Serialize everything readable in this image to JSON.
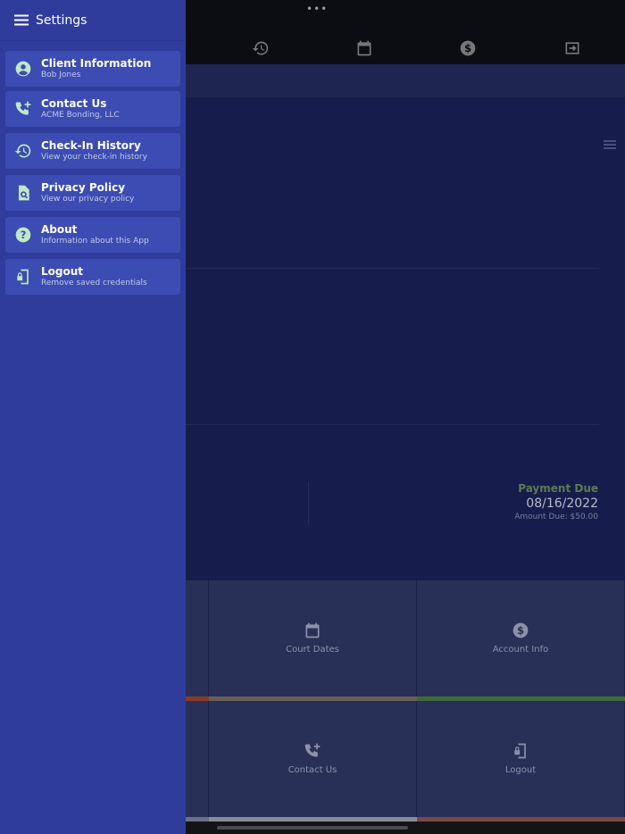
{
  "drawer": {
    "title": "Settings",
    "items": [
      {
        "title": "Client Information",
        "subtitle": "Bob Jones",
        "icon": "account-circle-icon"
      },
      {
        "title": "Contact Us",
        "subtitle": "ACME Bonding, LLC",
        "icon": "phone-plus-icon"
      },
      {
        "title": "Check-In History",
        "subtitle": "View your check-in history",
        "icon": "history-icon"
      },
      {
        "title": "Privacy Policy",
        "subtitle": "View our privacy policy",
        "icon": "file-search-icon"
      },
      {
        "title": "About",
        "subtitle": "Information about this App",
        "icon": "help-circle-icon"
      },
      {
        "title": "Logout",
        "subtitle": "Remove saved credentials",
        "icon": "phone-lock-icon"
      }
    ]
  },
  "top": {
    "dots": "•••"
  },
  "payment": {
    "title": "Payment Due",
    "date": "08/16/2022",
    "amount": "Amount Due: $50.00"
  },
  "tiles": [
    {
      "label": "Court Dates"
    },
    {
      "label": "Account Info"
    },
    {
      "label": "Contact Us"
    },
    {
      "label": "Logout"
    }
  ],
  "colors": {
    "drawer": "#2f3c9c",
    "accent": "#bfe8c8",
    "bar_red": "#8a3a2a",
    "bar_tan": "#6a5e5a",
    "bar_green": "#3f6a3a",
    "bar_gray": "#8a8c98",
    "bar_rose": "#7a4848"
  }
}
